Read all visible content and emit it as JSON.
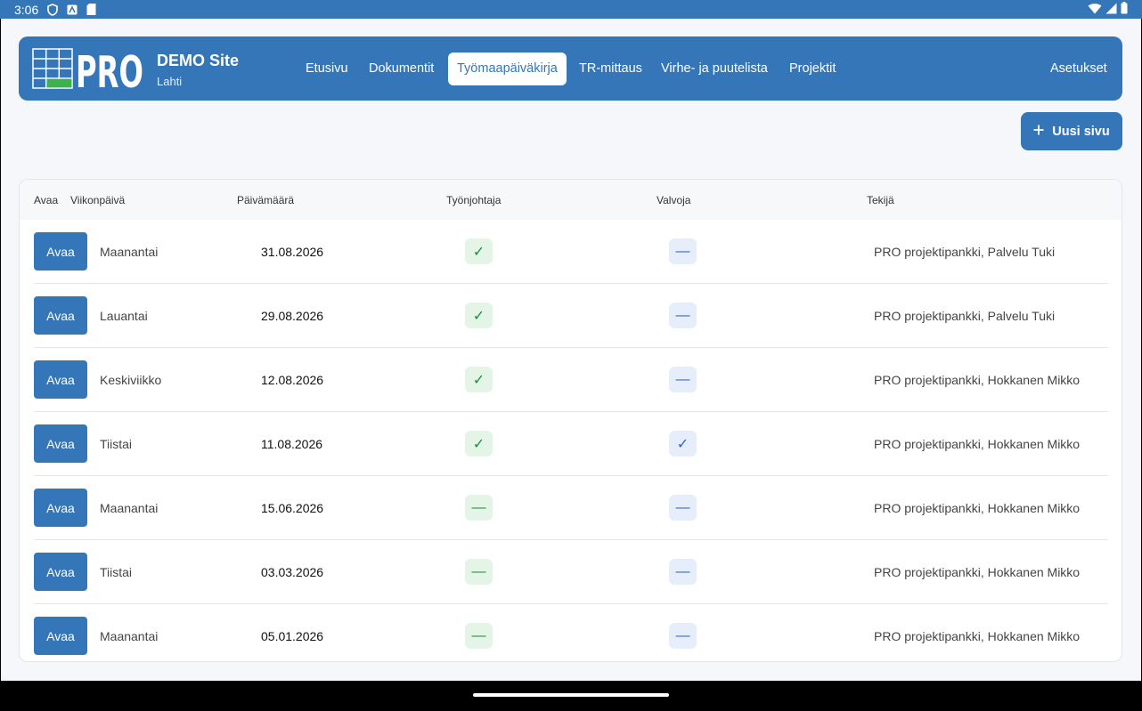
{
  "status": {
    "time": "3:06"
  },
  "site": {
    "logo_text": "PRO",
    "name": "DEMO Site",
    "city": "Lahti"
  },
  "nav": {
    "etusivu": "Etusivu",
    "dokumentit": "Dokumentit",
    "tyomaapaivakirja": "Työmaapäiväkirja",
    "tr_mittaus": "TR-mittaus",
    "virhe": "Virhe- ja puutelista",
    "projektit": "Projektit",
    "asetukset": "Asetukset"
  },
  "new_page_label": "Uusi sivu",
  "table": {
    "headers": {
      "open": "Avaa",
      "weekday": "Viikonpäivä",
      "date": "Päivämäärä",
      "foreman": "Työnjohtaja",
      "supervisor": "Valvoja",
      "author": "Tekijä"
    },
    "rows": [
      {
        "button": "Avaa",
        "weekday": "Maanantai",
        "date": "31.08.2026",
        "foreman": "✓",
        "supervisor": "—",
        "author": "PRO projektipankki, Palvelu Tuki"
      },
      {
        "button": "Avaa",
        "weekday": "Lauantai",
        "date": "29.08.2026",
        "foreman": "✓",
        "supervisor": "—",
        "author": "PRO projektipankki, Palvelu Tuki"
      },
      {
        "button": "Avaa",
        "weekday": "Keskiviikko",
        "date": "12.08.2026",
        "foreman": "✓",
        "supervisor": "—",
        "author": "PRO projektipankki, Hokkanen Mikko"
      },
      {
        "button": "Avaa",
        "weekday": "Tiistai",
        "date": "11.08.2026",
        "foreman": "✓",
        "supervisor": "✓",
        "author": "PRO projektipankki, Hokkanen Mikko"
      },
      {
        "button": "Avaa",
        "weekday": "Maanantai",
        "date": "15.06.2026",
        "foreman": "—",
        "supervisor": "—",
        "author": "PRO projektipankki, Hokkanen Mikko"
      },
      {
        "button": "Avaa",
        "weekday": "Tiistai",
        "date": "03.03.2026",
        "foreman": "—",
        "supervisor": "—",
        "author": "PRO projektipankki, Hokkanen Mikko"
      },
      {
        "button": "Avaa",
        "weekday": "Maanantai",
        "date": "05.01.2026",
        "foreman": "—",
        "supervisor": "—",
        "author": "PRO projektipankki, Hokkanen Mikko"
      }
    ]
  },
  "colors": {
    "brand": "#3476b7",
    "check_green": "#1a8f3c",
    "check_blue": "#2d63c8",
    "background": "#f5f7fa"
  }
}
